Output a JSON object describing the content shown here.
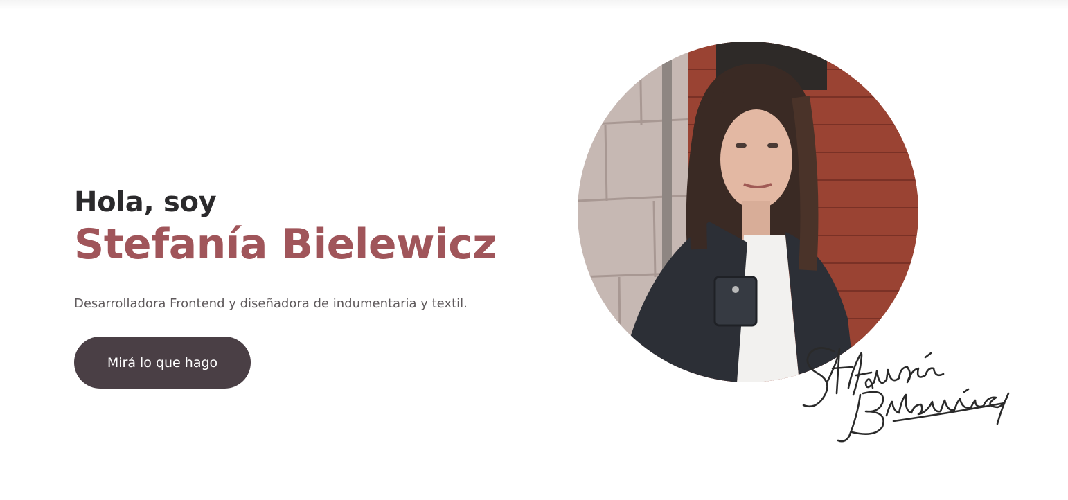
{
  "hero": {
    "greeting": "Hola, soy",
    "name": "Stefanía Bielewicz",
    "tagline": "Desarrolladora Frontend y diseñadora de indumentaria y textil.",
    "cta_label": "Mirá lo que hago"
  },
  "signature": {
    "text": "Stefanía Bielewicz"
  },
  "colors": {
    "name_accent": "#a0555a",
    "button_bg": "#4a3f45",
    "heading": "#2b2a2c",
    "body_text": "#5f5a5c"
  }
}
